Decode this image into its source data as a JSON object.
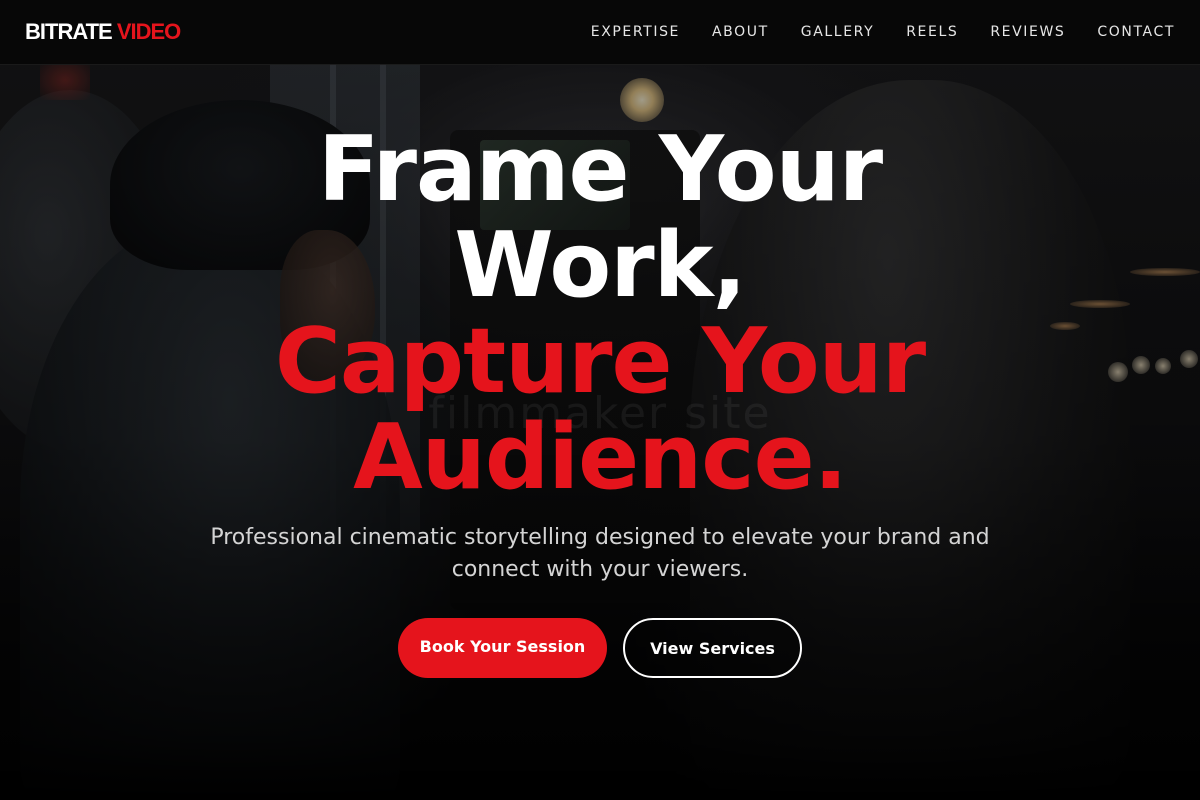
{
  "brand": {
    "logo_white": "BITRATE",
    "logo_red": "VIDEO",
    "accent_color": "#e5141c"
  },
  "nav": {
    "items": [
      {
        "label": "EXPERTISE"
      },
      {
        "label": "ABOUT"
      },
      {
        "label": "GALLERY"
      },
      {
        "label": "REELS"
      },
      {
        "label": "REVIEWS"
      },
      {
        "label": "CONTACT"
      }
    ]
  },
  "hero": {
    "headline_white_1": "Frame Your",
    "headline_white_2": "Work,",
    "headline_red_1": "Capture Your",
    "headline_red_2": "Audience.",
    "ghost_text": "filmmaker site",
    "subtitle": "Professional cinematic storytelling designed to elevate your brand and connect with your viewers.",
    "primary_cta": "Book Your Session",
    "secondary_cta": "View Services"
  }
}
